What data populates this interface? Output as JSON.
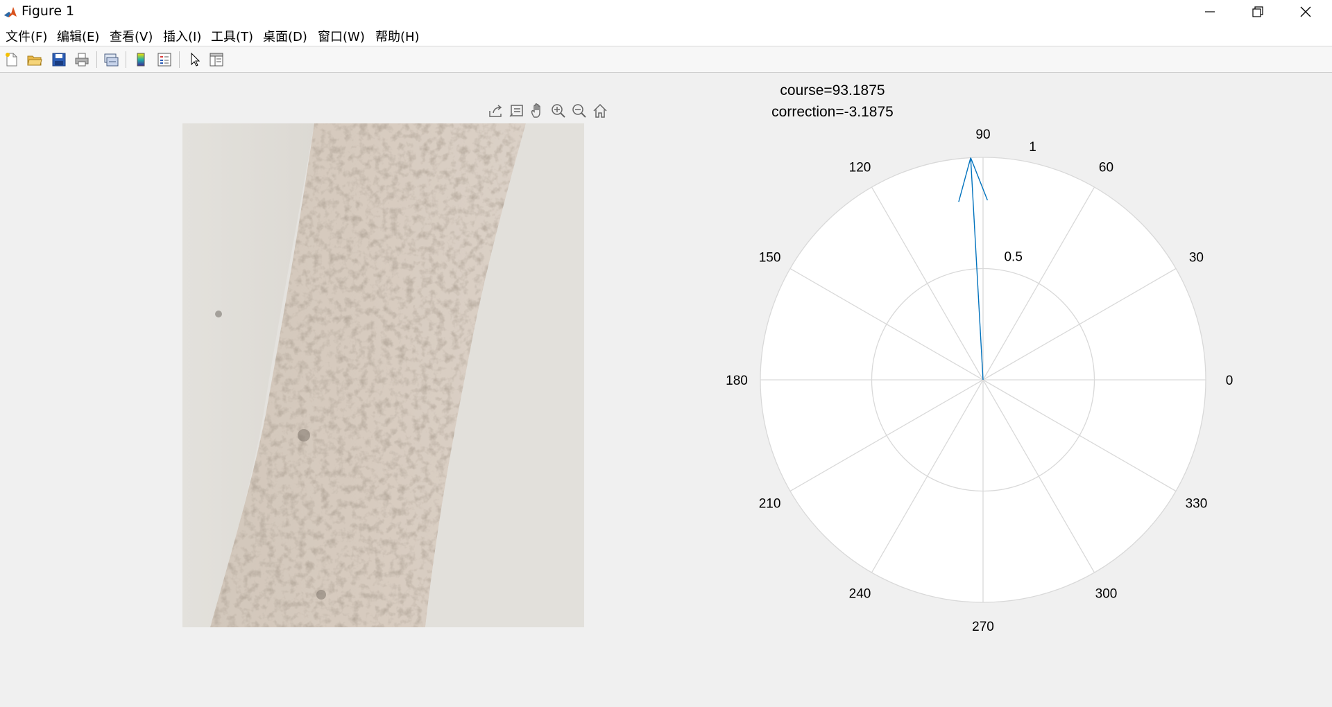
{
  "window": {
    "title": "Figure 1",
    "app_icon": "matlab-icon",
    "controls": [
      "minimize-icon",
      "maximize-icon",
      "close-icon"
    ]
  },
  "menu": {
    "items": [
      "文件(F)",
      "编辑(E)",
      "查看(V)",
      "插入(I)",
      "工具(T)",
      "桌面(D)",
      "窗口(W)",
      "帮助(H)"
    ]
  },
  "toolbar": {
    "buttons": [
      "new-figure-icon",
      "open-file-icon",
      "save-icon",
      "print-icon",
      "link-plot-icon",
      "colorbar-icon",
      "legend-icon",
      "edit-plot-icon",
      "property-inspector-icon"
    ]
  },
  "axes_toolbar": {
    "buttons": [
      "export-icon",
      "data-tips-icon",
      "pan-icon",
      "zoom-in-icon",
      "zoom-out-icon",
      "home-icon"
    ]
  },
  "image_panel": {
    "description_icon": "photo-texture"
  },
  "polar": {
    "title_line1": "course=93.1875",
    "title_line2": "correction=-3.1875",
    "angle_labels": [
      "0",
      "30",
      "60",
      "90",
      "120",
      "150",
      "180",
      "210",
      "240",
      "270",
      "300",
      "330"
    ],
    "radial_labels": [
      "0.5",
      "1"
    ],
    "grid_color": "#d9d9d9",
    "line_color": "#0072bd"
  },
  "chart_data": {
    "type": "polar",
    "title": [
      "course=93.1875",
      "correction=-3.1875"
    ],
    "theta_ticks_deg": [
      0,
      30,
      60,
      90,
      120,
      150,
      180,
      210,
      240,
      270,
      300,
      330
    ],
    "r_ticks": [
      0.5,
      1
    ],
    "rlim": [
      0,
      1
    ],
    "series": [
      {
        "type": "compass-arrow",
        "theta_deg": 93.1875,
        "r": 1
      }
    ],
    "grid": true
  }
}
